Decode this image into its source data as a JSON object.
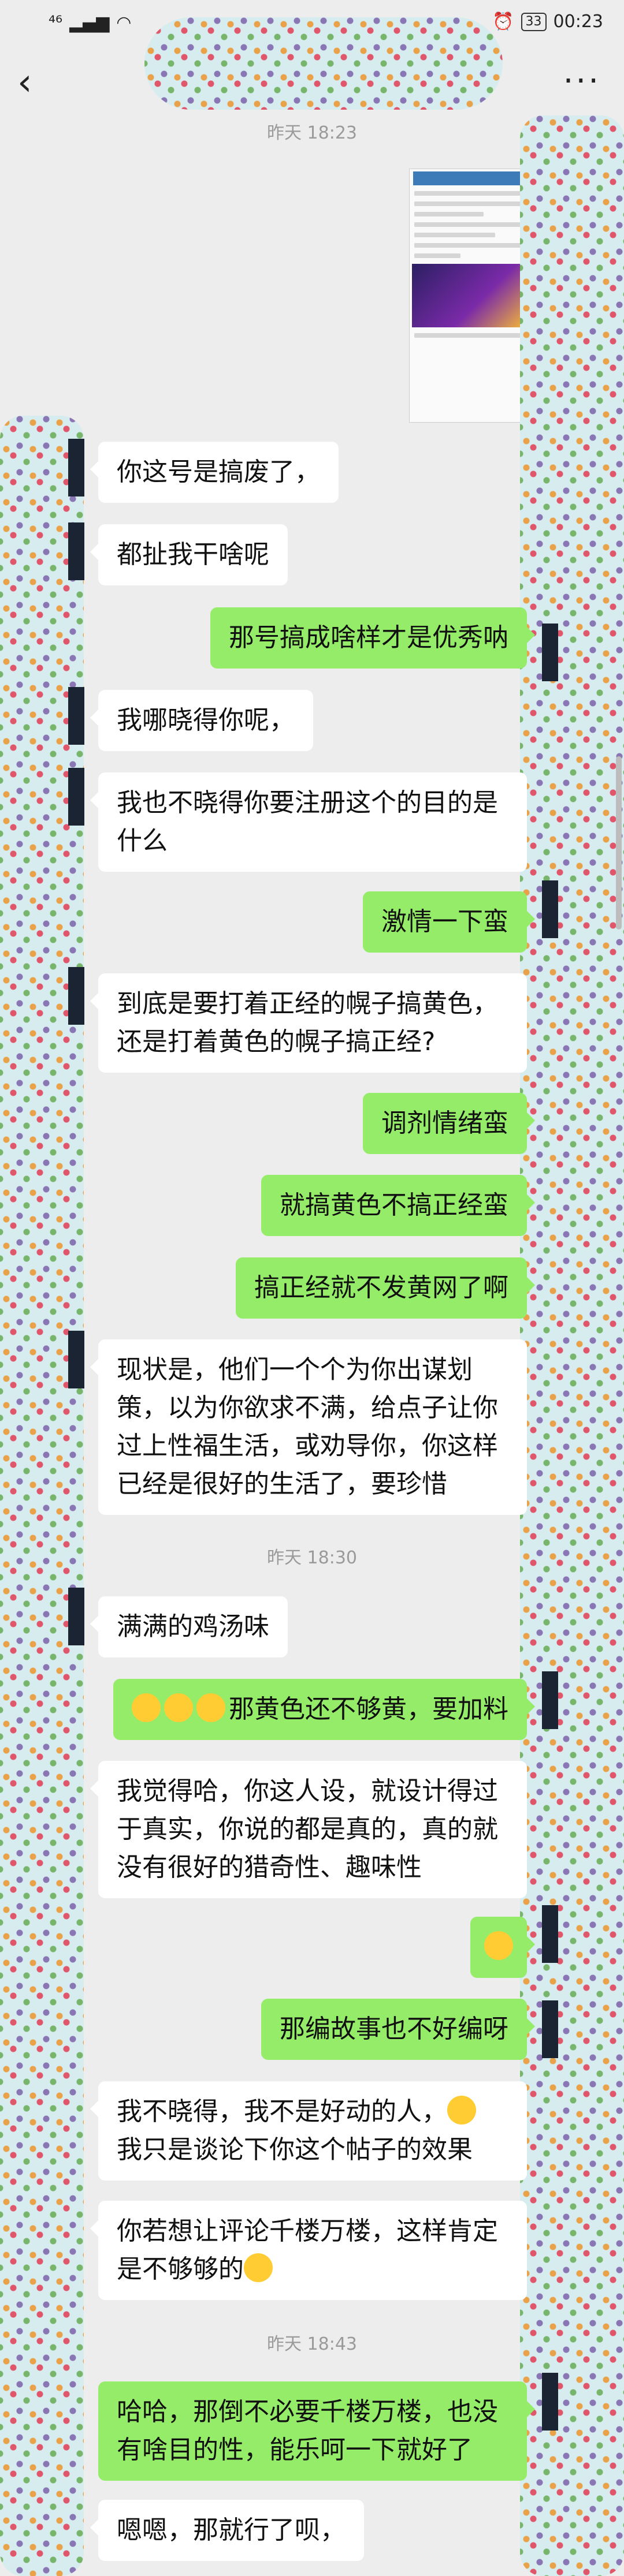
{
  "status": {
    "network": "⁴⁶",
    "battery": "33",
    "time": "00:23"
  },
  "nav": {
    "back": "‹",
    "more": "···"
  },
  "timestamps": [
    "昨天 18:23",
    "昨天 18:30",
    "昨天 18:43"
  ],
  "messages": [
    {
      "side": "in",
      "text": "你这号是搞废了，"
    },
    {
      "side": "in",
      "text": "都扯我干啥呢"
    },
    {
      "side": "out",
      "text": "那号搞成啥样才是优秀呐"
    },
    {
      "side": "in",
      "text": "我哪晓得你呢，"
    },
    {
      "side": "in",
      "text": "我也不晓得你要注册这个的目的是什么"
    },
    {
      "side": "out",
      "text": "激情一下蛮"
    },
    {
      "side": "in",
      "text": "到底是要打着正经的幌子搞黄色，还是打着黄色的幌子搞正经?"
    },
    {
      "side": "out",
      "text": "调剂情绪蛮"
    },
    {
      "side": "out",
      "text": "就搞黄色不搞正经蛮"
    },
    {
      "side": "out",
      "text": "搞正经就不发黄网了啊"
    },
    {
      "side": "in",
      "text": "现状是，他们一个个为你出谋划策，以为你欲求不满，给点子让你过上性福生活，或劝导你，你这样已经是很好的生活了，要珍惜"
    },
    {
      "side": "in",
      "text": "满满的鸡汤味"
    },
    {
      "side": "out",
      "text": "那黄色还不够黄，要加料"
    },
    {
      "side": "in",
      "text": "我觉得哈，你这人设，就设计得过于真实，你说的都是真的，真的就没有很好的猎奇性、趣味性"
    },
    {
      "side": "out",
      "text": ""
    },
    {
      "side": "out",
      "text": "那编故事也不好编呀"
    },
    {
      "side": "in",
      "text": "我不晓得，我不是好动的人，"
    },
    {
      "side": "in",
      "text": "我只是谈论下你这个帖子的效果"
    },
    {
      "side": "in",
      "text": "你若想让评论千楼万楼，这样肯定是不够够的"
    },
    {
      "side": "out",
      "text": "哈哈，那倒不必要千楼万楼，也没有啥目的性，能乐呵一下就好了"
    },
    {
      "side": "in",
      "text": "嗯嗯，那就行了呗，"
    }
  ],
  "colors": {
    "in_bubble": "#ffffff",
    "out_bubble": "#95ec69",
    "background": "#ededed"
  }
}
